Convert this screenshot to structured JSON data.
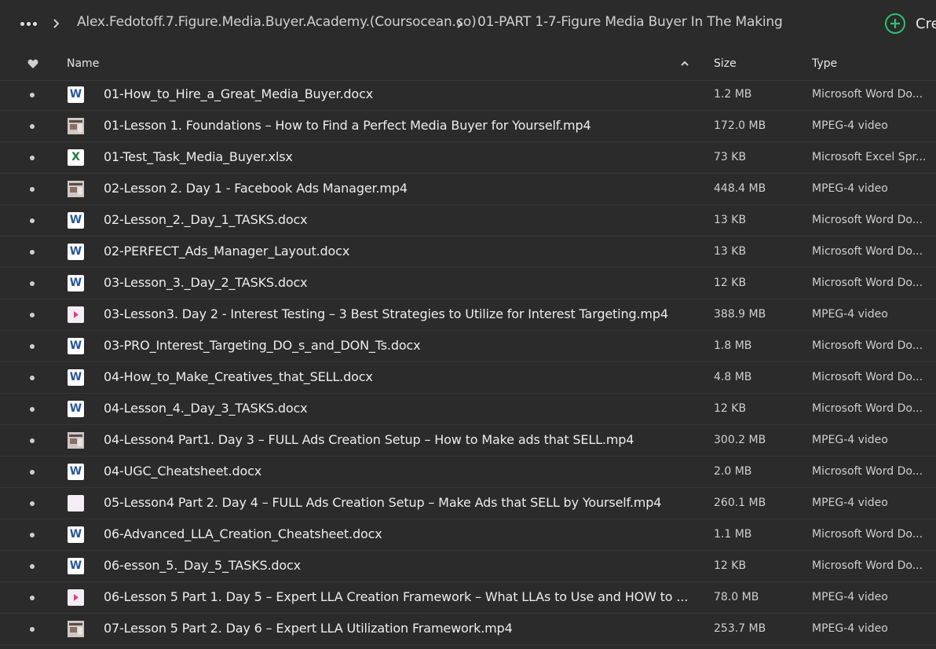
{
  "breadcrumb": {
    "items": [
      "Alex.Fedotoff.7.Figure.Media.Buyer.Academy.(Coursocean.co)",
      "01-PART 1-7-Figure Media Buyer In The Making"
    ],
    "create_label": "Cre"
  },
  "columns": {
    "name": "Name",
    "size": "Size",
    "type": "Type"
  },
  "files": [
    {
      "name": "01-How_to_Hire_a_Great_Media_Buyer.docx",
      "size": "1.2 MB",
      "type": "Microsoft Word Do...",
      "icon": "word-icon"
    },
    {
      "name": "01-Lesson 1. Foundations – How to Find a Perfect Media Buyer for Yourself.mp4",
      "size": "172.0 MB",
      "type": "MPEG-4 video",
      "icon": "video-thumbnail-icon"
    },
    {
      "name": "01-Test_Task_Media_Buyer.xlsx",
      "size": "73 KB",
      "type": "Microsoft Excel Spr...",
      "icon": "excel-icon"
    },
    {
      "name": "02-Lesson 2. Day 1 - Facebook Ads Manager.mp4",
      "size": "448.4 MB",
      "type": "MPEG-4 video",
      "icon": "video-thumbnail-icon"
    },
    {
      "name": "02-Lesson_2._Day_1_TASKS.docx",
      "size": "13 KB",
      "type": "Microsoft Word Do...",
      "icon": "word-icon"
    },
    {
      "name": "02-PERFECT_Ads_Manager_Layout.docx",
      "size": "13 KB",
      "type": "Microsoft Word Do...",
      "icon": "word-icon"
    },
    {
      "name": "03-Lesson_3._Day_2_TASKS.docx",
      "size": "12 KB",
      "type": "Microsoft Word Do...",
      "icon": "word-icon"
    },
    {
      "name": "03-Lesson3. Day 2 - Interest Testing – 3 Best Strategies to Utilize for Interest Targeting.mp4",
      "size": "388.9 MB",
      "type": "MPEG-4 video",
      "icon": "video-play-icon"
    },
    {
      "name": "03-PRO_Interest_Targeting_DO_s_and_DON_Ts.docx",
      "size": "1.8 MB",
      "type": "Microsoft Word Do...",
      "icon": "word-icon"
    },
    {
      "name": "04-How_to_Make_Creatives_that_SELL.docx",
      "size": "4.8 MB",
      "type": "Microsoft Word Do...",
      "icon": "word-icon"
    },
    {
      "name": "04-Lesson_4._Day_3_TASKS.docx",
      "size": "12 KB",
      "type": "Microsoft Word Do...",
      "icon": "word-icon"
    },
    {
      "name": "04-Lesson4 Part1. Day 3 – FULL Ads Creation Setup – How to Make ads that SELL.mp4",
      "size": "300.2 MB",
      "type": "MPEG-4 video",
      "icon": "video-thumbnail-icon"
    },
    {
      "name": "04-UGC_Cheatsheet.docx",
      "size": "2.0 MB",
      "type": "Microsoft Word Do...",
      "icon": "word-icon"
    },
    {
      "name": "05-Lesson4 Part 2. Day 4 – FULL Ads Creation Setup – Make Ads that SELL by Yourself.mp4",
      "size": "260.1 MB",
      "type": "MPEG-4 video",
      "icon": "video-blank-icon"
    },
    {
      "name": "06-Advanced_LLA_Creation_Cheatsheet.docx",
      "size": "1.1 MB",
      "type": "Microsoft Word Do...",
      "icon": "word-icon"
    },
    {
      "name": "06-esson_5._Day_5_TASKS.docx",
      "size": "12 KB",
      "type": "Microsoft Word Do...",
      "icon": "word-icon"
    },
    {
      "name": "06-Lesson 5 Part 1. Day 5 – Expert LLA Creation Framework – What LLAs to Use and HOW to ...",
      "size": "78.0 MB",
      "type": "MPEG-4 video",
      "icon": "video-play-icon"
    },
    {
      "name": "07-Lesson 5 Part 2. Day 6 – Expert LLA Utilization Framework.mp4",
      "size": "253.7 MB",
      "type": "MPEG-4 video",
      "icon": "video-thumbnail-icon"
    }
  ],
  "icon_glyphs": {
    "word": "W",
    "excel": "X"
  },
  "colors": {
    "background": "#2b2b2b",
    "accent_green": "#2fbf71",
    "word_blue": "#2b579a",
    "excel_green": "#1d7a3a",
    "play_pink": "#e0408a"
  }
}
